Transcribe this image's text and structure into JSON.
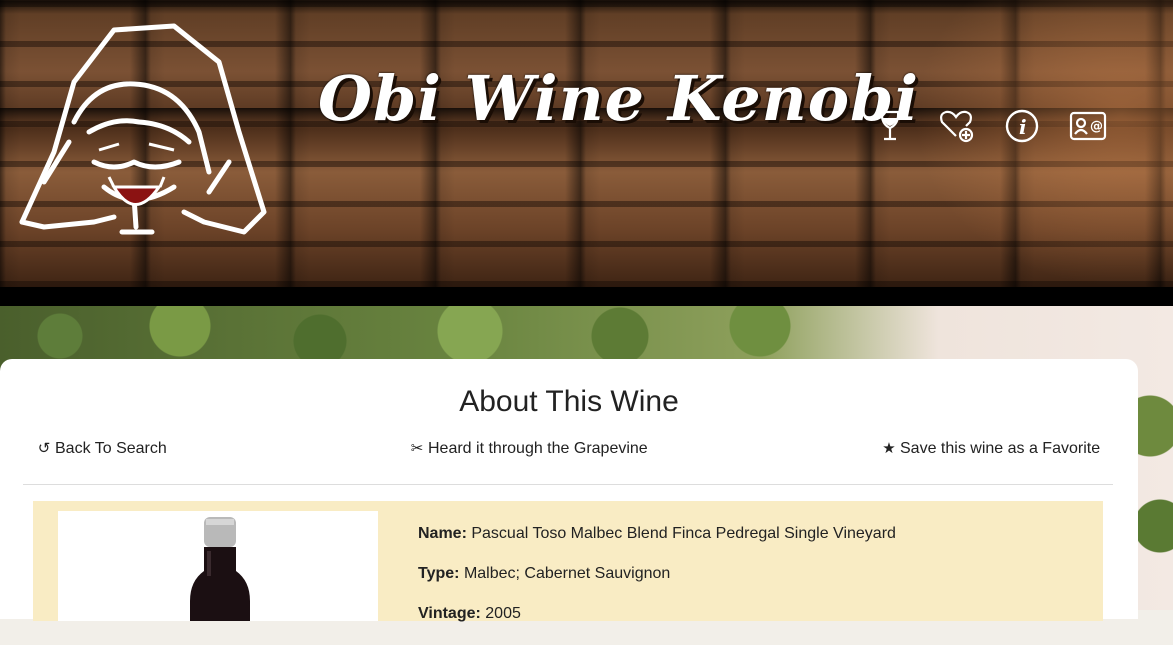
{
  "header": {
    "site_title": "Obi Wine Kenobi",
    "nav_icons": [
      "wine-glass-icon",
      "heart-plus-icon",
      "info-icon",
      "contact-card-icon"
    ]
  },
  "card": {
    "title": "About This Wine",
    "actions": {
      "back": {
        "label": "Back To Search",
        "icon": "undo-icon"
      },
      "grapevine": {
        "label": "Heard it through the Grapevine",
        "icon": "ear-icon"
      },
      "favorite": {
        "label": "Save this wine as a Favorite",
        "icon": "star-icon"
      }
    },
    "wine": {
      "name_label": "Name:",
      "name_value": "Pascual Toso Malbec Blend Finca Pedregal Single Vineyard",
      "type_label": "Type:",
      "type_value": "Malbec; Cabernet Sauvignon",
      "vintage_label": "Vintage:",
      "vintage_value": "2005"
    }
  },
  "colors": {
    "details_bg": "#f9ecc4",
    "card_bg": "#ffffff",
    "header_band": "#000000"
  }
}
